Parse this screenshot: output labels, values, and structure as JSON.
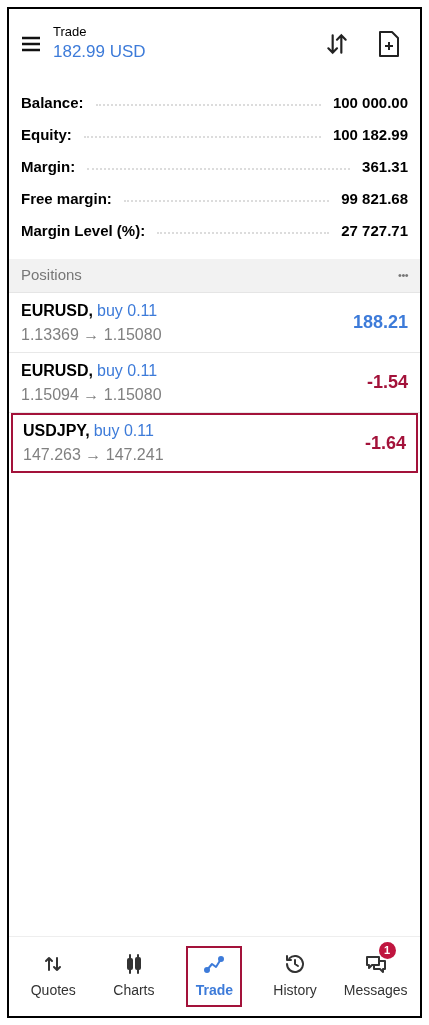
{
  "header": {
    "title": "Trade",
    "subtitle": "182.99 USD"
  },
  "summary": [
    {
      "label": "Balance:",
      "value": "100 000.00"
    },
    {
      "label": "Equity:",
      "value": "100 182.99"
    },
    {
      "label": "Margin:",
      "value": "361.31"
    },
    {
      "label": "Free margin:",
      "value": "99 821.68"
    },
    {
      "label": "Margin Level (%):",
      "value": "27 727.71"
    }
  ],
  "positions_header": {
    "title": "Positions",
    "menu": "•••"
  },
  "positions": [
    {
      "symbol": "EURUSD,",
      "order": "buy 0.11",
      "prices": "1.13369 → 1.15080",
      "profit": "188.21",
      "color": "#3d7bd9",
      "highlighted": false
    },
    {
      "symbol": "EURUSD,",
      "order": "buy 0.11",
      "prices": "1.15094 → 1.15080",
      "profit": "-1.54",
      "color": "#a3123a",
      "highlighted": false
    },
    {
      "symbol": "USDJPY,",
      "order": "buy 0.11",
      "prices": "147.263 → 147.241",
      "profit": "-1.64",
      "color": "#a3123a",
      "highlighted": true
    }
  ],
  "nav": [
    {
      "kind": "quotes",
      "label": "Quotes",
      "selected": false,
      "highlighted": false
    },
    {
      "kind": "charts",
      "label": "Charts",
      "selected": false,
      "highlighted": false
    },
    {
      "kind": "trade",
      "label": "Trade",
      "selected": true,
      "highlighted": true
    },
    {
      "kind": "history",
      "label": "History",
      "selected": false,
      "highlighted": false
    },
    {
      "kind": "messages",
      "label": "Messages",
      "selected": false,
      "highlighted": false,
      "badge": "1"
    }
  ]
}
